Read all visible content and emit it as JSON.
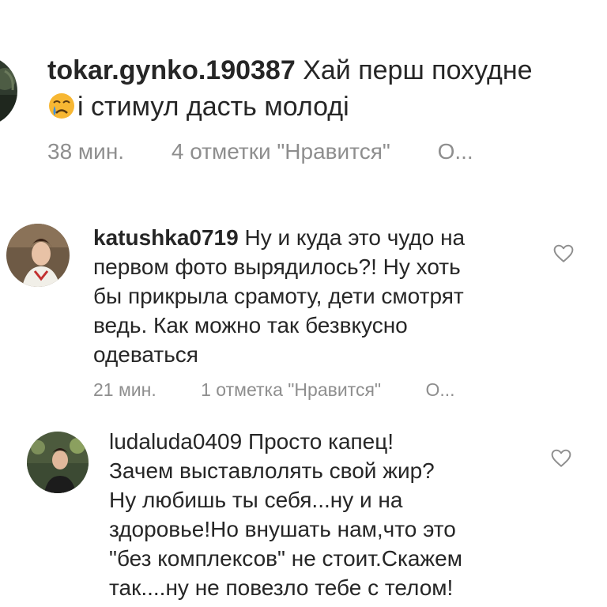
{
  "comments": [
    {
      "username": "tokar.gynko.190387",
      "text_line1": "Хай перш похудне",
      "text_line2": "і стимул дасть молоді",
      "emoji": "crying-face-emoji",
      "time": "38 мин.",
      "likes": "4 отметки \"Нравится\"",
      "reply": "О..."
    },
    {
      "username": "katushka0719",
      "text_first": "Ну и куда это чудо на",
      "text_rest": [
        "первом фото вырядилось?! Ну хоть",
        "бы прикрыла срамоту, дети смотрят",
        "ведь. Как можно так безвкусно",
        "одеваться"
      ],
      "time": "21 мин.",
      "likes": "1 отметка \"Нравится\"",
      "reply": "О..."
    },
    {
      "username": "ludaluda0409",
      "text_first": "Просто капец!",
      "text_rest": [
        "Зачем выставлолять свой жир?",
        "Ну любишь ты себя...ну и на",
        "здоровье!Но внушать нам,что это",
        "\"без комплексов\" не стоит.Скажем",
        "так....ну не повезло тебе с телом!"
      ]
    }
  ],
  "colors": {
    "text": "#262626",
    "meta": "#8e8e8e",
    "heart": "#8e8e8e"
  },
  "icons": [
    "heart-icon",
    "crying-face-emoji",
    "avatar"
  ]
}
